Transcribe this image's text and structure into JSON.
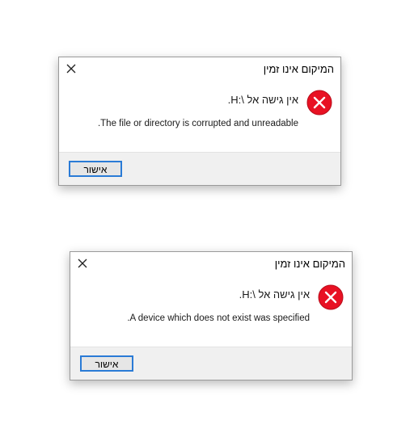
{
  "dialogs": [
    {
      "title": "המיקום אינו זמין",
      "heading": "אין גישה אל \\:H.",
      "message": "The file or directory is corrupted and unreadable.",
      "ok_label": "אישור",
      "icon": "error-icon"
    },
    {
      "title": "המיקום אינו זמין",
      "heading": "אין גישה אל \\:H.",
      "message": "A device which does not exist was specified.",
      "ok_label": "אישור",
      "icon": "error-icon"
    }
  ],
  "colors": {
    "error_red": "#e81123",
    "button_border": "#2a7bd6",
    "footer_bg": "#f0f0f0"
  }
}
